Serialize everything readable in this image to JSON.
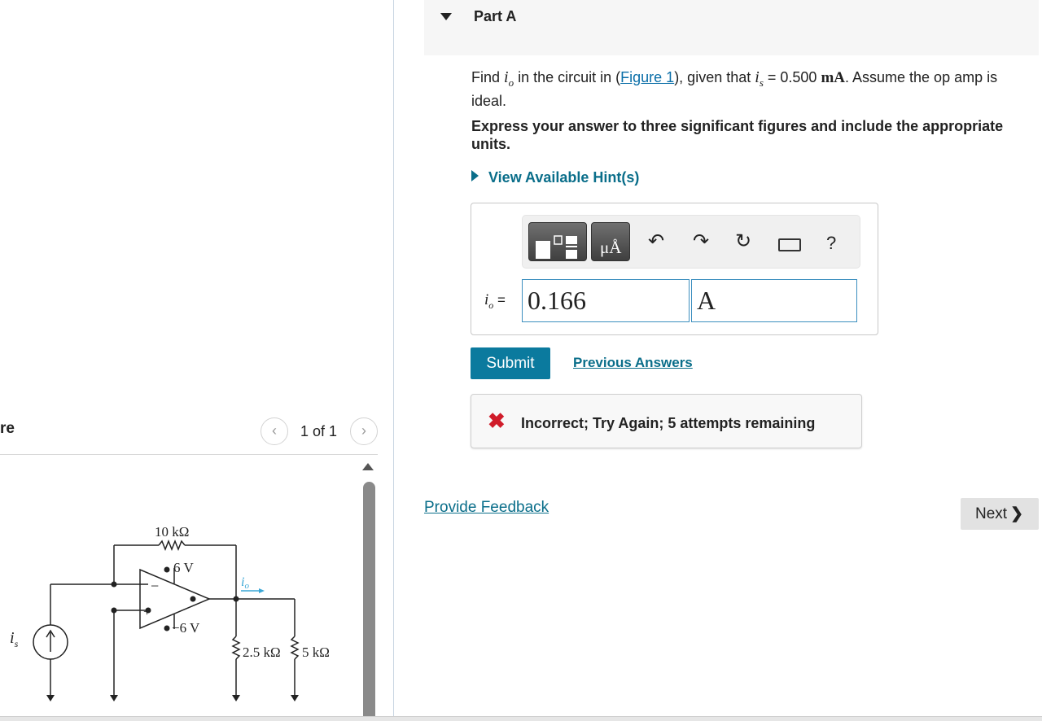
{
  "figure_panel": {
    "title": "re",
    "counter": "1 of 1",
    "prev_icon": "chevron-left-icon",
    "next_icon": "chevron-right-icon",
    "circuit": {
      "feedback_resistor": "10 kΩ",
      "pos_supply": "6 V",
      "neg_supply": "−6 V",
      "output_current_label": "i",
      "output_current_sub": "o",
      "source_label": "i",
      "source_sub": "s",
      "load_1": "2.5 kΩ",
      "load_2": "5 kΩ",
      "minus_sign": "−",
      "plus_sign": "+"
    }
  },
  "part": {
    "title": "Part A",
    "caret_icon": "caret-down-icon"
  },
  "question": {
    "find": "Find ",
    "io_sym": "i",
    "io_sub": "o",
    "in_circuit": " in the circuit in (",
    "figure_link": "Figure 1",
    "given": "), given that ",
    "is_sym": "i",
    "is_sub": "s",
    "equals": " = 0.500 ",
    "unit": "mA",
    "assume": ". Assume the op amp is ideal."
  },
  "instruction": "Express your answer to three significant figures and include the appropriate units.",
  "hints_label": "View Available Hint(s)",
  "toolbar": {
    "templates_icon": "templates-icon",
    "units_label": "μÅ",
    "undo_icon": "undo-icon",
    "redo_icon": "redo-icon",
    "reset_icon": "reset-icon",
    "keyboard_icon": "keyboard-icon",
    "help_label": "?"
  },
  "answer": {
    "var_sym": "i",
    "var_sub": "o",
    "equals": " =",
    "value": "0.166",
    "unit": "A"
  },
  "submit_label": "Submit",
  "previous_answers_label": "Previous Answers",
  "feedback": {
    "icon": "x-icon",
    "text": "Incorrect; Try Again; 5 attempts remaining",
    "icon_color": "#d01c2a"
  },
  "provide_feedback_label": "Provide Feedback",
  "next_label": "Next",
  "colors": {
    "accent": "#0b7a9e",
    "link": "#0a6e8a",
    "field_border": "#3c8fbf"
  }
}
